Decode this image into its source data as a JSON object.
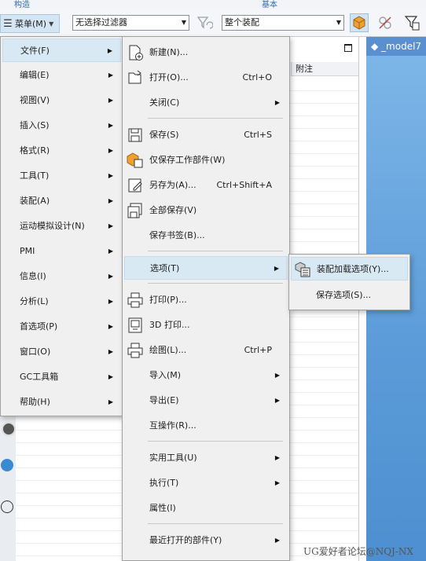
{
  "ribbon": {
    "left_label": "构造",
    "right_label": "基本"
  },
  "toolbar": {
    "menu_label": "菜单(M)",
    "filter_value": "无选择过滤器",
    "scope_value": "整个装配"
  },
  "navigator": {
    "column_header": "附注"
  },
  "viewport": {
    "tab_title": "_model7"
  },
  "main_menu": [
    {
      "label": "文件(F)",
      "submenu": true,
      "highlighted": true
    },
    {
      "label": "编辑(E)",
      "submenu": true
    },
    {
      "label": "视图(V)",
      "submenu": true
    },
    {
      "label": "插入(S)",
      "submenu": true
    },
    {
      "label": "格式(R)",
      "submenu": true
    },
    {
      "label": "工具(T)",
      "submenu": true
    },
    {
      "label": "装配(A)",
      "submenu": true
    },
    {
      "label": "运动模拟设计(N)",
      "submenu": true
    },
    {
      "label": "PMI",
      "submenu": true
    },
    {
      "label": "信息(I)",
      "submenu": true
    },
    {
      "label": "分析(L)",
      "submenu": true
    },
    {
      "label": "首选项(P)",
      "submenu": true
    },
    {
      "label": "窗口(O)",
      "submenu": true
    },
    {
      "label": "GC工具箱",
      "submenu": true
    },
    {
      "label": "帮助(H)",
      "submenu": true
    }
  ],
  "file_menu": [
    {
      "label": "新建(N)...",
      "shortcut": "",
      "icon": "new-file-icon"
    },
    {
      "label": "打开(O)...",
      "shortcut": "Ctrl+O",
      "icon": "open-folder-icon"
    },
    {
      "label": "关闭(C)",
      "shortcut": "",
      "submenu": true
    },
    {
      "label": "保存(S)",
      "shortcut": "Ctrl+S",
      "icon": "save-icon"
    },
    {
      "label": "仅保存工作部件(W)",
      "shortcut": "",
      "icon": "save-work-part-icon"
    },
    {
      "label": "另存为(A)...",
      "shortcut": "Ctrl+Shift+A",
      "icon": "save-as-icon"
    },
    {
      "label": "全部保存(V)",
      "shortcut": "",
      "icon": "save-all-icon"
    },
    {
      "label": "保存书签(B)...",
      "shortcut": ""
    },
    {
      "label": "选项(T)",
      "shortcut": "",
      "submenu": true,
      "highlighted": true
    },
    {
      "label": "打印(P)...",
      "shortcut": "",
      "icon": "print-icon"
    },
    {
      "label": "3D 打印...",
      "shortcut": "",
      "icon": "3d-print-icon"
    },
    {
      "label": "绘图(L)...",
      "shortcut": "Ctrl+P",
      "icon": "plot-icon"
    },
    {
      "label": "导入(M)",
      "shortcut": "",
      "submenu": true
    },
    {
      "label": "导出(E)",
      "shortcut": "",
      "submenu": true
    },
    {
      "label": "互操作(R)...",
      "shortcut": ""
    },
    {
      "label": "实用工具(U)",
      "shortcut": "",
      "submenu": true
    },
    {
      "label": "执行(T)",
      "shortcut": "",
      "submenu": true
    },
    {
      "label": "属性(I)",
      "shortcut": ""
    },
    {
      "label": "最近打开的部件(Y)",
      "shortcut": "",
      "submenu": true
    }
  ],
  "options_menu": [
    {
      "label": "装配加载选项(Y)...",
      "icon": "assembly-load-options-icon",
      "highlighted": true
    },
    {
      "label": "保存选项(S)..."
    }
  ],
  "watermark": "UG爱好者论坛@NQJ-NX"
}
